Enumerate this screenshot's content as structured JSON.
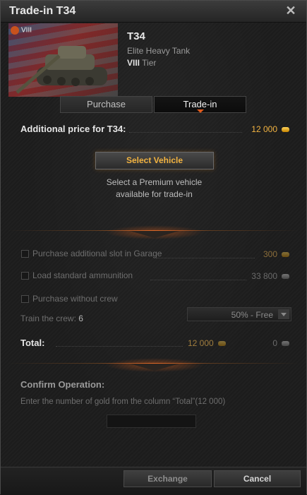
{
  "window": {
    "title": "Trade-in T34"
  },
  "tank": {
    "name": "T34",
    "class": "Elite Heavy Tank",
    "tier_numeral": "VIII",
    "tier_word": "Tier",
    "badge_tier": "VIII"
  },
  "tabs": {
    "purchase": "Purchase",
    "tradein": "Trade-in",
    "active": "Trade-in"
  },
  "additional_price": {
    "label": "Additional price for T34:",
    "value": "12 000",
    "currency": "gold-coin-icon"
  },
  "select_vehicle": {
    "button": "Select Vehicle",
    "hint_line1": "Select a Premium vehicle",
    "hint_line2": "available for trade-in"
  },
  "options": {
    "slot": {
      "label": "Purchase additional slot in Garage",
      "value": "300",
      "currency": "gold-coin-icon",
      "checked": false
    },
    "ammo": {
      "label": "Load standard ammunition",
      "value": "33 800",
      "currency": "silver-coin-icon",
      "checked": false
    },
    "no_crew": {
      "label": "Purchase without crew",
      "checked": false
    },
    "train_crew": {
      "label": "Train the crew:",
      "count": "6",
      "selected": "50% - Free"
    }
  },
  "total": {
    "label": "Total:",
    "gold": "12 000",
    "silver": "0"
  },
  "confirm": {
    "title": "Confirm Operation:",
    "instruction": "Enter the number of gold from the column “Total”(12 000)",
    "input_value": ""
  },
  "footer": {
    "exchange": "Exchange",
    "cancel": "Cancel"
  },
  "colors": {
    "accent": "#e05a1c",
    "gold_text": "#f2b341",
    "background": "#1c1c1c"
  }
}
